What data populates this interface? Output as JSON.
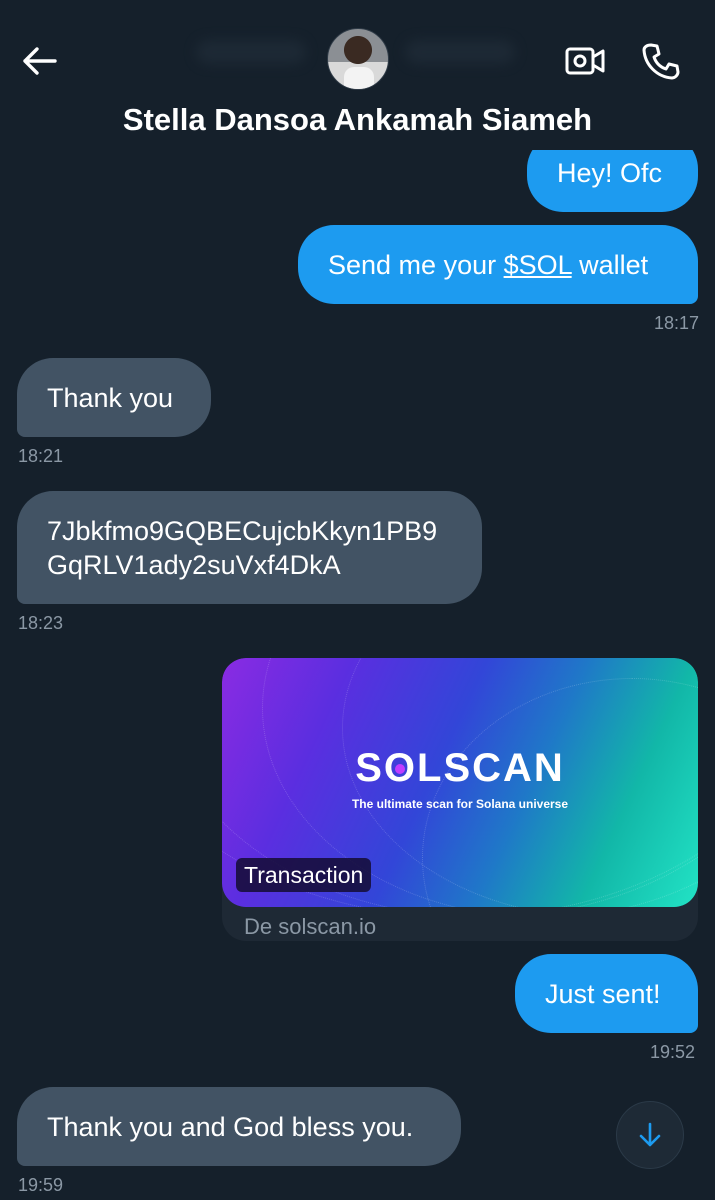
{
  "header": {
    "contact_name": "Stella Dansoa Ankamah Siameh",
    "back_icon": "arrow-left-icon",
    "video_icon": "video-camera-icon",
    "call_icon": "phone-icon"
  },
  "messages": [
    {
      "direction": "out",
      "text": "Hey! Ofc"
    },
    {
      "direction": "out",
      "text_before": "Send me your ",
      "link": "$SOL",
      "text_after": " wallet",
      "time": "18:17"
    },
    {
      "direction": "in",
      "text": "Thank you",
      "time": "18:21"
    },
    {
      "direction": "in",
      "lines": [
        "7Jbkfmo9GQBECujcbKkyn1PB9",
        "GqRLV1ady2suVxf4DkA"
      ],
      "time": "18:23"
    },
    {
      "direction": "out",
      "type": "link_card",
      "card": {
        "logo": "SOLSCAN",
        "tagline": "The ultimate scan for Solana universe",
        "badge": "Transaction",
        "domain": "De solscan.io"
      }
    },
    {
      "direction": "out",
      "text": "Just sent!",
      "time": "19:52"
    },
    {
      "direction": "in",
      "text": "Thank you and God bless you.",
      "time": "19:59"
    }
  ],
  "scroll_button": {
    "icon": "arrow-down-icon"
  },
  "colors": {
    "background": "#15202b",
    "outgoing_bubble": "#1d9bf0",
    "incoming_bubble": "#425364",
    "timestamp": "#8b98a5"
  }
}
